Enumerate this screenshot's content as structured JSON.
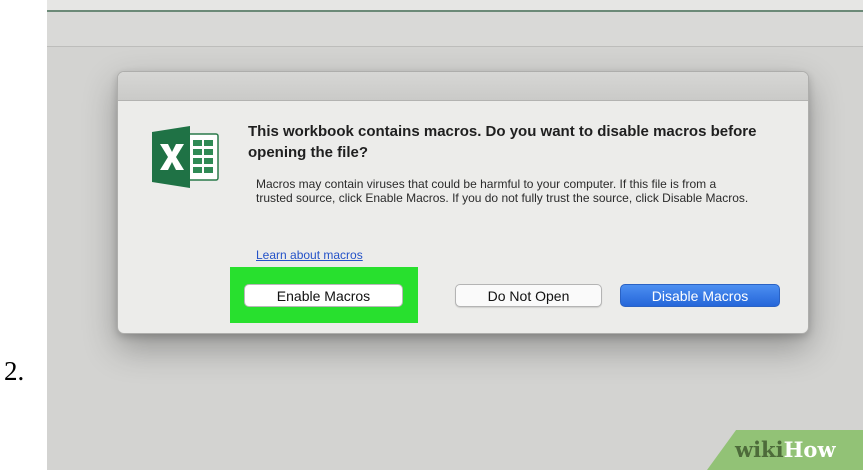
{
  "step": {
    "number": "2."
  },
  "dialog": {
    "app_icon": "excel-icon",
    "headline": "This workbook contains macros. Do you want to disable macros before opening the file?",
    "body": "Macros may contain viruses that could be harmful to your computer.  If this file is from a trusted source, click Enable Macros. If you do not fully trust the source, click Disable Macros.",
    "link": "Learn about macros",
    "buttons": {
      "enable": "Enable Macros",
      "do_not_open": "Do Not Open",
      "disable": "Disable Macros"
    },
    "highlight_color": "#28e02e",
    "default_button_color": "#2f74e3"
  },
  "watermark": {
    "part1": "wiki",
    "part2": "How"
  }
}
